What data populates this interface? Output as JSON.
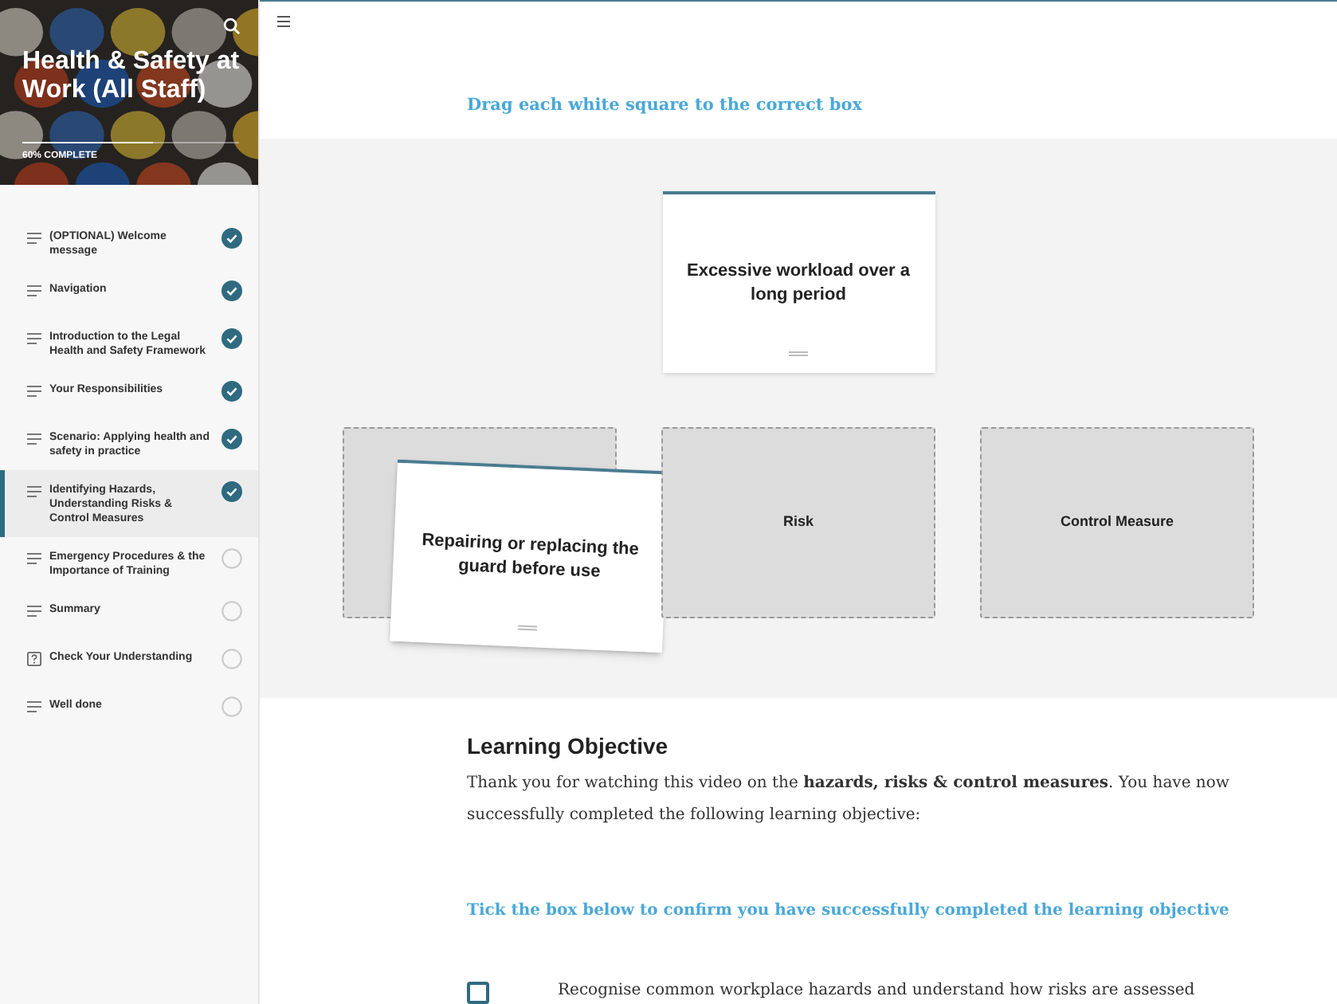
{
  "course": {
    "title": "Health & Safety at Work (All Staff)",
    "progress_label": "60% COMPLETE",
    "level": 0.6
  },
  "lessons": [
    {
      "title": "(OPTIONAL) Welcome message",
      "kind": "lesson",
      "completed": true,
      "selected": false
    },
    {
      "title": "Navigation",
      "kind": "lesson",
      "completed": true,
      "selected": false
    },
    {
      "title": "Introduction to the Legal Health and Safety Framework",
      "kind": "lesson",
      "completed": true,
      "selected": false
    },
    {
      "title": "Your Responsibilities",
      "kind": "lesson",
      "completed": true,
      "selected": false
    },
    {
      "title": "Scenario: Applying health and safety in practice",
      "kind": "lesson",
      "completed": true,
      "selected": false
    },
    {
      "title": "Identifying Hazards, Understanding Risks & Control Measures",
      "kind": "lesson",
      "completed": true,
      "selected": true
    },
    {
      "title": "Emergency Procedures & the Importance of Training",
      "kind": "lesson",
      "completed": false,
      "selected": false
    },
    {
      "title": "Summary",
      "kind": "lesson",
      "completed": false,
      "selected": false
    },
    {
      "title": "Check Your Understanding",
      "kind": "quiz",
      "completed": false,
      "selected": false
    },
    {
      "title": "Well done",
      "kind": "lesson",
      "completed": false,
      "selected": false
    }
  ],
  "activity": {
    "instruction": "Drag each white square to the correct box",
    "source_card": "Excessive workload over a long period",
    "dragged_card": "Repairing or replacing the guard before use",
    "drop_zones": [
      {
        "kind": "covered"
      },
      {
        "kind": "labelled",
        "label": "Risk"
      },
      {
        "kind": "labelled",
        "label": "Control Measure"
      }
    ]
  },
  "objective": {
    "heading": "Learning Objective",
    "body": "Thank you for watching this video on the **hazards, risks & control measures**. You have now successfully completed the following learning objective:",
    "prompt": "Tick the box below to confirm you have successfully completed the learning objective",
    "items": [
      {
        "text": "Recognise common workplace hazards and understand how risks are assessed",
        "checked": false
      }
    ]
  }
}
